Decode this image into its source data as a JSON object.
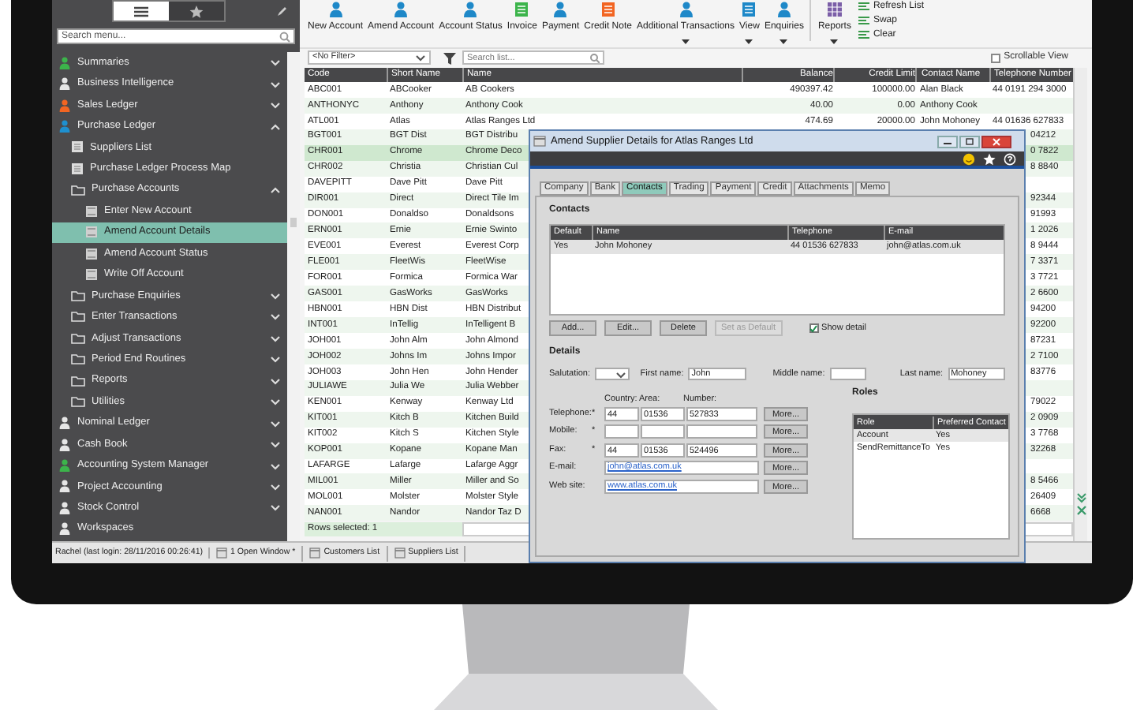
{
  "sidebar": {
    "view_toggle": [
      {
        "kind": "menu",
        "selected": true
      },
      {
        "kind": "favourites",
        "selected": false
      }
    ],
    "search": {
      "placeholder": "Search menu..."
    },
    "items": [
      {
        "kind": "module",
        "label": "Summaries",
        "color": "#3cb44b",
        "expanded": false,
        "selected": false
      },
      {
        "kind": "module",
        "label": "Business Intelligence",
        "color": "#e6e6e6",
        "expanded": false,
        "selected": false
      },
      {
        "kind": "module",
        "label": "Sales Ledger",
        "color": "#f26522",
        "expanded": false,
        "selected": false
      },
      {
        "kind": "module",
        "label": "Purchase Ledger",
        "color": "#1e90d0",
        "expanded": true,
        "selected": false,
        "children": [
          {
            "kind": "page",
            "label": "Suppliers List",
            "selected": false
          },
          {
            "kind": "page",
            "label": "Purchase Ledger Process Map",
            "selected": false
          },
          {
            "kind": "folder",
            "label": "Purchase Accounts",
            "expanded": true,
            "selected": false,
            "children": [
              {
                "kind": "form",
                "label": "Enter New Account",
                "selected": false
              },
              {
                "kind": "form",
                "label": "Amend Account Details",
                "selected": true
              },
              {
                "kind": "form",
                "label": "Amend Account Status",
                "selected": false
              },
              {
                "kind": "form",
                "label": "Write Off Account",
                "selected": false
              }
            ]
          },
          {
            "kind": "folder",
            "label": "Purchase Enquiries",
            "expanded": false,
            "selected": false
          },
          {
            "kind": "folder",
            "label": "Enter Transactions",
            "expanded": false,
            "selected": false
          },
          {
            "kind": "folder",
            "label": "Adjust Transactions",
            "expanded": false,
            "selected": false
          },
          {
            "kind": "folder",
            "label": "Period End Routines",
            "expanded": false,
            "selected": false
          },
          {
            "kind": "folder",
            "label": "Reports",
            "expanded": false,
            "selected": false
          },
          {
            "kind": "folder",
            "label": "Utilities",
            "expanded": false,
            "selected": false
          }
        ]
      },
      {
        "kind": "module",
        "label": "Nominal Ledger",
        "color": "#e6e6e6",
        "expanded": false,
        "selected": false
      },
      {
        "kind": "module",
        "label": "Cash Book",
        "color": "#e6e6e6",
        "expanded": false,
        "selected": false
      },
      {
        "kind": "module",
        "label": "Accounting System Manager",
        "color": "#3cb44b",
        "expanded": false,
        "selected": false
      },
      {
        "kind": "module",
        "label": "Project Accounting",
        "color": "#e6e6e6",
        "expanded": false,
        "selected": false
      },
      {
        "kind": "module",
        "label": "Stock Control",
        "color": "#e6e6e6",
        "expanded": false,
        "selected": false
      },
      {
        "kind": "module",
        "label": "Workspaces",
        "color": "#e6e6e6",
        "selected": false
      }
    ]
  },
  "toolbar": {
    "buttons": [
      {
        "label": "New Account",
        "kind": "person",
        "color": "#1e88c8",
        "dropdown": false
      },
      {
        "label": "Amend Account",
        "kind": "person",
        "color": "#1e88c8",
        "dropdown": false
      },
      {
        "label": "Account Status",
        "kind": "person",
        "color": "#1e88c8",
        "dropdown": false
      },
      {
        "label": "Invoice",
        "kind": "document",
        "color": "#3cb44b",
        "dropdown": false
      },
      {
        "label": "Payment",
        "kind": "person",
        "color": "#1e88c8",
        "dropdown": false
      },
      {
        "label": "Credit Note",
        "kind": "document",
        "color": "#f26522",
        "dropdown": false
      },
      {
        "label": "Additional Transactions",
        "kind": "person",
        "color": "#1e88c8",
        "dropdown": true
      },
      {
        "label": "View",
        "kind": "list",
        "color": "#1e88c8",
        "dropdown": true
      },
      {
        "label": "Enquiries",
        "kind": "person",
        "color": "#1e88c8",
        "dropdown": true
      },
      {
        "label": "Reports",
        "kind": "grid",
        "color": "#7b5ea7",
        "dropdown": true
      }
    ],
    "small_actions": [
      "Refresh List",
      "Swap",
      "Clear"
    ]
  },
  "filter": {
    "value": "<No Filter>",
    "search_placeholder": "Search list...",
    "scrollable_view": {
      "label": "Scrollable View",
      "checked": false
    }
  },
  "table": {
    "columns": [
      "Code",
      "Short Name",
      "Name",
      "Balance",
      "Credit Limit",
      "Contact Name",
      "Telephone Number"
    ],
    "rows": [
      {
        "kind": "full",
        "selected": false,
        "cells": [
          "ABC001",
          "ABCooker",
          "AB Cookers",
          "490397.42",
          "100000.00",
          "Alan Black",
          "44 0191 294 3000"
        ]
      },
      {
        "kind": "full",
        "selected": false,
        "cells": [
          "ANTHONYC",
          "Anthony",
          "Anthony Cook",
          "40.00",
          "0.00",
          "Anthony Cook"
        ]
      },
      {
        "kind": "full",
        "selected": false,
        "cells": [
          "ATL001",
          "Atlas",
          "Atlas Ranges Ltd",
          "474.69",
          "20000.00",
          "John Mohoney",
          "44 01636 627833"
        ]
      },
      {
        "kind": "partial",
        "selected": false,
        "cells": [
          "BGT001",
          "BGT Dist",
          "BGT Distribu",
          "04212"
        ]
      },
      {
        "kind": "partial",
        "selected": true,
        "cells": [
          "CHR001",
          "Chrome",
          "Chrome Deco",
          "0 7822"
        ]
      },
      {
        "kind": "partial",
        "selected": false,
        "cells": [
          "CHR002",
          "Christia",
          "Christian Cul",
          "8 8840"
        ]
      },
      {
        "kind": "partial",
        "selected": false,
        "cells": [
          "DAVEPITT",
          "Dave Pitt",
          "Dave Pitt"
        ]
      },
      {
        "kind": "partial",
        "selected": false,
        "cells": [
          "DIR001",
          "Direct",
          "Direct Tile Im",
          "92344"
        ]
      },
      {
        "kind": "partial",
        "selected": false,
        "cells": [
          "DON001",
          "Donaldso",
          "Donaldsons",
          "91993"
        ]
      },
      {
        "kind": "partial",
        "selected": false,
        "cells": [
          "ERN001",
          "Ernie",
          "Ernie Swinto",
          "1 2026"
        ]
      },
      {
        "kind": "partial",
        "selected": false,
        "cells": [
          "EVE001",
          "Everest",
          "Everest Corp",
          "8 9444"
        ]
      },
      {
        "kind": "partial",
        "selected": false,
        "cells": [
          "FLE001",
          "FleetWis",
          "FleetWise",
          "7 3371"
        ]
      },
      {
        "kind": "partial",
        "selected": false,
        "cells": [
          "FOR001",
          "Formica",
          "Formica War",
          "3 7721"
        ]
      },
      {
        "kind": "partial",
        "selected": false,
        "cells": [
          "GAS001",
          "GasWorks",
          "GasWorks",
          "2 6600"
        ]
      },
      {
        "kind": "partial",
        "selected": false,
        "cells": [
          "HBN001",
          "HBN Dist",
          "HBN Distribut",
          "94200"
        ]
      },
      {
        "kind": "partial",
        "selected": false,
        "cells": [
          "INT001",
          "InTellig",
          "InTelligent B",
          "92200"
        ]
      },
      {
        "kind": "partial",
        "selected": false,
        "cells": [
          "JOH001",
          "John Alm",
          "John Almond",
          "87231"
        ]
      },
      {
        "kind": "partial",
        "selected": false,
        "cells": [
          "JOH002",
          "Johns Im",
          "Johns Impor",
          "2 7100"
        ]
      },
      {
        "kind": "partial",
        "selected": false,
        "cells": [
          "JOH003",
          "John Hen",
          "John Hender",
          "83776"
        ]
      },
      {
        "kind": "partial",
        "selected": false,
        "cells": [
          "JULIAWE",
          "Julia We",
          "Julia Webber"
        ]
      },
      {
        "kind": "partial",
        "selected": false,
        "cells": [
          "KEN001",
          "Kenway",
          "Kenway Ltd",
          "79022"
        ]
      },
      {
        "kind": "partial",
        "selected": false,
        "cells": [
          "KIT001",
          "Kitch B",
          "Kitchen Build",
          "2 0909"
        ]
      },
      {
        "kind": "partial",
        "selected": false,
        "cells": [
          "KIT002",
          "Kitch S",
          "Kitchen Style",
          "3 7768"
        ]
      },
      {
        "kind": "partial",
        "selected": false,
        "cells": [
          "KOP001",
          "Kopane",
          "Kopane Man",
          "32268"
        ]
      },
      {
        "kind": "partial",
        "selected": false,
        "cells": [
          "LAFARGE",
          "Lafarge",
          "Lafarge Aggr"
        ]
      },
      {
        "kind": "partial",
        "selected": false,
        "cells": [
          "MIL001",
          "Miller",
          "Miller and So",
          "8 5466"
        ]
      },
      {
        "kind": "partial",
        "selected": false,
        "cells": [
          "MOL001",
          "Molster",
          "Molster Style",
          "26409"
        ]
      },
      {
        "kind": "partial",
        "selected": false,
        "cells": [
          "NAN001",
          "Nandor",
          "Nandor Taz D",
          "6668"
        ]
      }
    ],
    "rows_selected": "Rows selected: 1"
  },
  "status_bar": {
    "user": "Rachel (last login: 28/11/2016 00:26:41)",
    "windows": "1 Open Window *",
    "tabs": [
      "Customers List",
      "Suppliers List"
    ]
  },
  "dialog": {
    "title": "Amend Supplier Details for Atlas Ranges Ltd",
    "tabs": [
      {
        "label": "Company",
        "selected": false
      },
      {
        "label": "Bank",
        "selected": false
      },
      {
        "label": "Contacts",
        "selected": true
      },
      {
        "label": "Trading",
        "selected": false
      },
      {
        "label": "Payment",
        "selected": false
      },
      {
        "label": "Credit",
        "selected": false
      },
      {
        "label": "Attachments",
        "selected": false
      },
      {
        "label": "Memo",
        "selected": false
      }
    ],
    "contacts_heading": "Contacts",
    "contacts_table": {
      "columns": [
        "Default",
        "Name",
        "Telephone",
        "E-mail"
      ],
      "rows": [
        {
          "selected": true,
          "cells": [
            "Yes",
            "John Mohoney",
            "44 01536 627833",
            "john@atlas.com.uk"
          ]
        }
      ]
    },
    "buttons": [
      {
        "label": "Add...",
        "disabled": false
      },
      {
        "label": "Edit...",
        "disabled": false
      },
      {
        "label": "Delete",
        "disabled": false
      },
      {
        "label": "Set as Default",
        "disabled": true
      }
    ],
    "show_detail": {
      "label": "Show detail",
      "checked": true
    },
    "details_heading": "Details",
    "name_fields": [
      {
        "kind": "select",
        "label": "Salutation:"
      },
      {
        "kind": "text",
        "label": "First name:",
        "value": "John"
      },
      {
        "kind": "text",
        "label": "Middle name:"
      },
      {
        "kind": "text",
        "label": "Last name:",
        "value": "Mohoney"
      }
    ],
    "phone_headers": [
      "Country:",
      "Area:",
      "Number:"
    ],
    "contact_rows": [
      {
        "kind": "phone",
        "label": "Telephone:",
        "marker": "*",
        "parts": [
          "44",
          "01536",
          "527833"
        ],
        "button": "More..."
      },
      {
        "kind": "phone",
        "label": "Mobile:",
        "marker": "*",
        "button": "More..."
      },
      {
        "kind": "phone",
        "label": "Fax:",
        "marker": "*",
        "parts": [
          "44",
          "01536",
          "524496"
        ],
        "button": "More..."
      },
      {
        "kind": "link",
        "label": "E-mail:",
        "value": "john@atlas.com.uk",
        "button": "More..."
      },
      {
        "kind": "link",
        "label": "Web site:",
        "value": "www.atlas.com.uk",
        "button": "More..."
      }
    ],
    "roles": {
      "heading": "Roles",
      "columns": [
        "Role",
        "Preferred Contact"
      ],
      "rows": [
        [
          "Account",
          "Yes"
        ],
        [
          "SendRemittanceTo",
          "Yes"
        ]
      ]
    }
  }
}
